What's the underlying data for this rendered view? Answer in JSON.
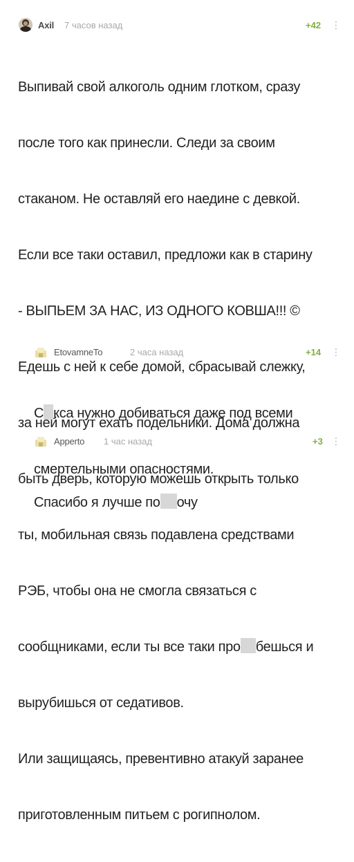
{
  "comments": [
    {
      "author": "Axil",
      "time": "7 часов назад",
      "rating": "+42",
      "more_icon": "vertical-dots-icon",
      "avatar_icon": "user-avatar",
      "lines": [
        "Выпивай свой алкоголь одним глотком, сразу",
        "после того как принесли. Следи за своим",
        "стаканом. Не оставляй его наедине с девкой.",
        "Если все таки оставил, предложи как в старину",
        "- ВЫПЬЕМ ЗА НАС, ИЗ ОДНОГО КОВША!!! ©",
        "Едешь с ней к себе домой, сбрасывай слежку,",
        "за ней могут ехать подельники. Дома должна",
        "быть дверь, которую можешь открыть только",
        "ты, мобильная связь подавлена средствами",
        "РЭБ, чтобы она не смогла связаться с",
        "сообщниками, если ты все таки про",
        "вырубишься от седативов.",
        "Или защищаясь, превентивно атакуй заранее",
        "приготовленным питьем с рогипнолом."
      ],
      "line_11_tail": "бешься и"
    },
    {
      "author": "EtovamneTo",
      "time": "2 часа назад",
      "rating": "+14",
      "more_icon": "vertical-dots-icon",
      "avatar_icon": "default-avatar-icon",
      "lines": [
        "кса нужно добиваться даже под всеми",
        "смертельными опасностями."
      ],
      "line_1_head": "С"
    },
    {
      "author": "Apperto",
      "time": "1 час назад",
      "rating": "+3",
      "more_icon": "vertical-dots-icon",
      "avatar_icon": "default-avatar-icon",
      "lines": [
        "Спасибо я лучше по",
        "очу"
      ]
    }
  ],
  "colors": {
    "rating": "#7fae3e",
    "author": "#4a4a4a",
    "time": "#a9a9a9",
    "text": "#222222",
    "redaction": "#d7d7d7"
  }
}
